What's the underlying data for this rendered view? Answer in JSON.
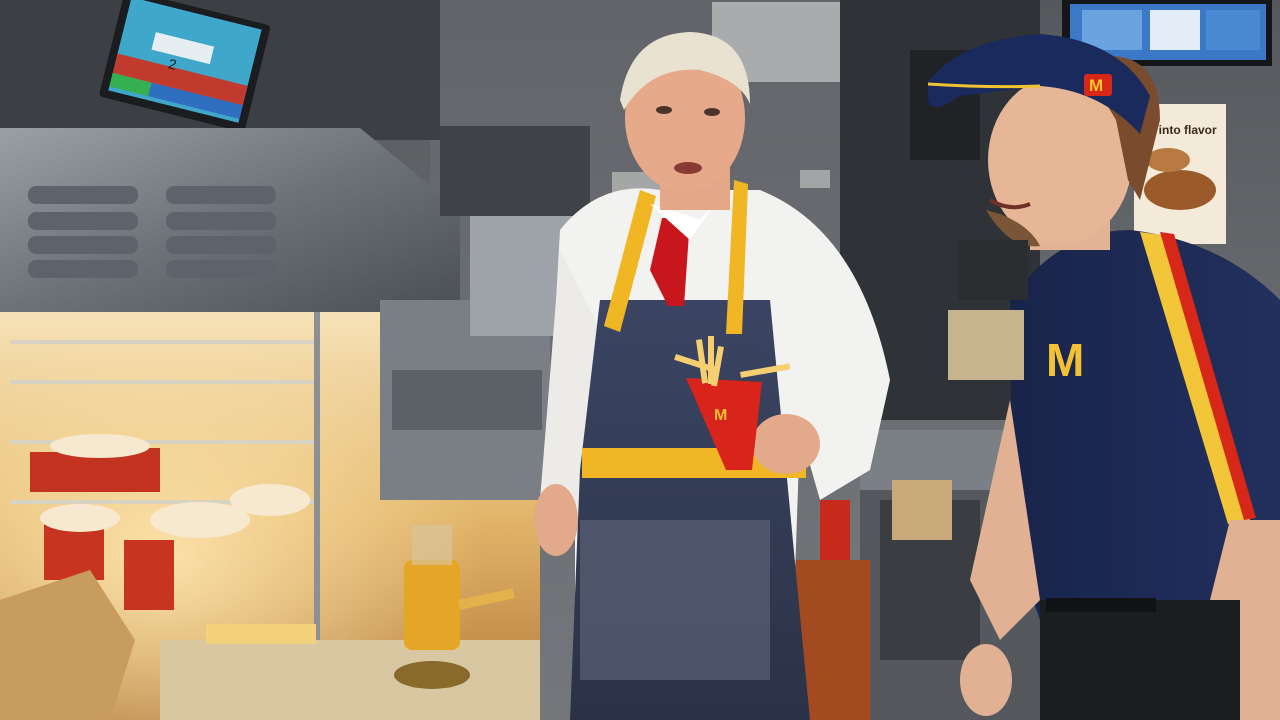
{
  "scene": {
    "description_free": true
  },
  "monitor_left": {
    "order_number": "2"
  },
  "poster_right": {
    "text": "all into flavor"
  },
  "logos": {
    "visor_logo": "M",
    "shirt_logo": "M",
    "fry_box_logo": "M"
  },
  "colors": {
    "brand_yellow": "#f6b81a",
    "brand_red": "#d62718",
    "uniform_navy": "#1c2a55",
    "apron_denim": "#36405a",
    "steel": "#8f959c",
    "warm_light": "#f3c77a"
  }
}
